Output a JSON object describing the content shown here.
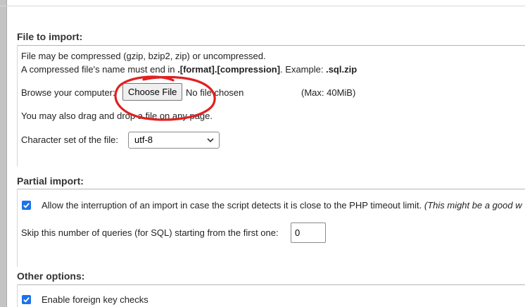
{
  "file_import": {
    "heading": "File to import:",
    "line1": "File may be compressed (gzip, bzip2, zip) or uncompressed.",
    "line2_prefix": "A compressed file's name must end in ",
    "line2_format": ".[format].[compression]",
    "line2_mid": ". Example: ",
    "line2_example": ".sql.zip",
    "browse_label": "Browse your computer:",
    "choose_button": "Choose File",
    "no_file_text": "No file chosen",
    "max_size": "(Max: 40MiB)",
    "drag_text": "You may also drag and drop a file on any page.",
    "charset_label": "Character set of the file:",
    "charset_value": "utf-8"
  },
  "partial_import": {
    "heading": "Partial import:",
    "allow_interrupt_label": "Allow the interruption of an import in case the script detects it is close to the PHP timeout limit.",
    "allow_interrupt_note": "(This might be a good w",
    "allow_interrupt_checked": true,
    "skip_label": "Skip this number of queries (for SQL) starting from the first one:",
    "skip_value": "0"
  },
  "other_options": {
    "heading": "Other options:",
    "foreign_key_label": "Enable foreign key checks",
    "foreign_key_checked": true
  },
  "colors": {
    "checkbox": "#1a73e8",
    "annotation_circle": "#e02020"
  },
  "icons": {
    "select_arrow": "chevron-down-icon",
    "checkbox_mark": "checkmark-icon"
  }
}
